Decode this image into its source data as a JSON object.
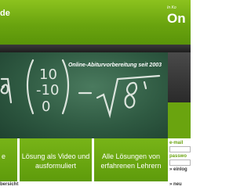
{
  "header": {
    "site_name": "de",
    "tagline": "In Ko",
    "brand": "On"
  },
  "hero": {
    "caption": "Online-Abiturvorbereitung seit 2003"
  },
  "features": [
    {
      "label": "e"
    },
    {
      "label": "Lösung als Video und ausformuliert"
    },
    {
      "label": "Alle Lösungen von erfahrenen Lehrern"
    }
  ],
  "side": {
    "email_label": "e-mail",
    "password_label": "passwo",
    "login_label": "» einlog",
    "new_label": "» neu"
  },
  "footer": {
    "overview_label": "bersicht"
  }
}
